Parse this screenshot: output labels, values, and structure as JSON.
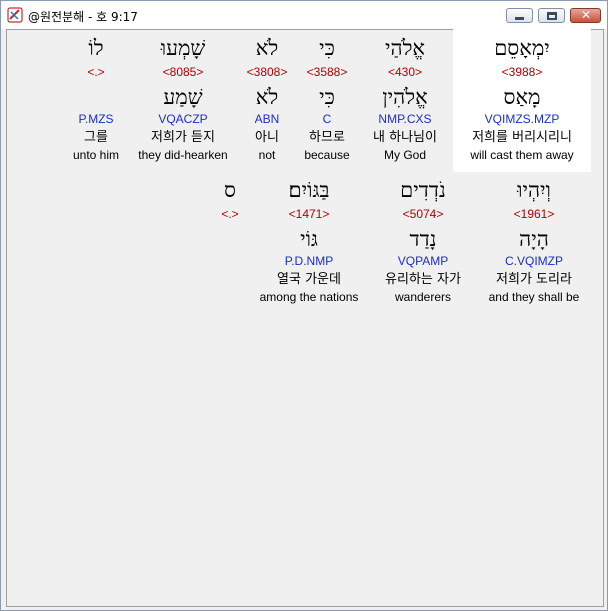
{
  "window": {
    "title": "@원전분해 - 호 9:17",
    "minimize_label": "",
    "maximize_label": "",
    "close_label": "✕"
  },
  "highlight_color": "#ffffff",
  "colors": {
    "strong": "#b00000",
    "morph": "#1a2ec8",
    "text": "#000000"
  },
  "words": [
    {
      "hebrew": "יִמְאָסֵם",
      "strong": "<3988>",
      "lemma": "מָאַס",
      "morph": "VQIMZS.MZP",
      "korean": "저희를 버리시리니",
      "english": "will cast them away",
      "highlighted": true
    },
    {
      "hebrew": "אֱלֹהַי",
      "strong": "<430>",
      "lemma": "אֱלֹהִין",
      "morph": "NMP.CXS",
      "korean": "내 하나님이",
      "english": "My God",
      "highlighted": false
    },
    {
      "hebrew": "כִּי",
      "strong": "<3588>",
      "lemma": "כִּי",
      "morph": "C",
      "korean": "하므로",
      "english": "because",
      "highlighted": false
    },
    {
      "hebrew": "לֹא",
      "strong": "<3808>",
      "lemma": "לֹא",
      "morph": "ABN",
      "korean": "아니",
      "english": "not",
      "highlighted": false
    },
    {
      "hebrew": "שָׁמְעוּ",
      "strong": "<8085>",
      "lemma": "שָׁמַע",
      "morph": "VQACZP",
      "korean": "저희가 듣지",
      "english": "they did-hearken",
      "highlighted": false
    },
    {
      "hebrew": "לוֹ",
      "strong": "<.>",
      "lemma": "",
      "morph": "P.MZS",
      "korean": "그를",
      "english": "unto him",
      "highlighted": false
    },
    {
      "hebrew": "וְיִהְיוּ",
      "strong": "<1961>",
      "lemma": "הָיָה",
      "morph": "C.VQIMZP",
      "korean": "저희가 도리라",
      "english": "and they shall be",
      "highlighted": false
    },
    {
      "hebrew": "נֹדְדִים",
      "strong": "<5074>",
      "lemma": "נָדַד",
      "morph": "VQPAMP",
      "korean": "유리하는 자가",
      "english": "wanderers",
      "highlighted": false
    },
    {
      "hebrew": "בַּגּוֹיִם׃",
      "strong": "<1471>",
      "lemma": "גּוֹי",
      "morph": "P.D.NMP",
      "korean": "열국 가운데",
      "english": "among the nations",
      "highlighted": false
    },
    {
      "hebrew": "ס",
      "strong": "<.>",
      "lemma": "",
      "morph": "",
      "korean": "",
      "english": "",
      "highlighted": false
    }
  ]
}
